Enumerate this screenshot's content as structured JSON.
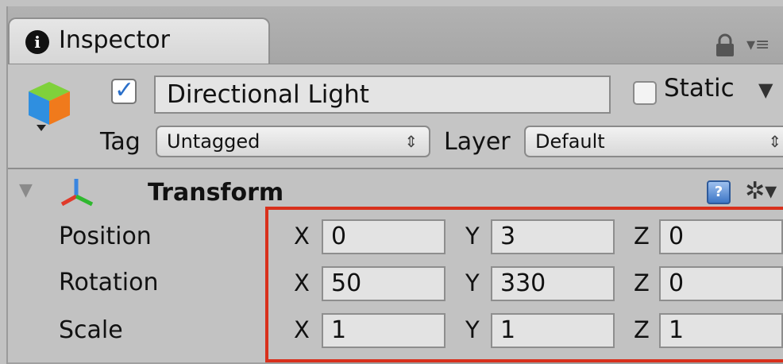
{
  "tab": {
    "icon": "info-icon",
    "icon_glyph": "i",
    "label": "Inspector"
  },
  "toolbar": {
    "lock_icon": "lock-icon",
    "menu_icon": "tab-menu-icon",
    "menu_glyph": "▾≡"
  },
  "gameobject": {
    "icon": "gameobject-cube-icon",
    "active_checked": true,
    "name": "Directional Light",
    "static_label": "Static",
    "static_checked": false,
    "static_dropdown_glyph": "▼",
    "tag_label": "Tag",
    "tag_value": "Untagged",
    "layer_label": "Layer",
    "layer_value": "Default",
    "dropdown_glyph": "⇕"
  },
  "component": {
    "foldout_glyph": "▼",
    "icon": "transform-axes-icon",
    "title": "Transform",
    "help_glyph": "?",
    "gear_glyph": "✲▾",
    "highlight_color": "#d8301c"
  },
  "transform": {
    "axis_labels": [
      "X",
      "Y",
      "Z"
    ],
    "rows": [
      {
        "label": "Position",
        "x": "0",
        "y": "3",
        "z": "0"
      },
      {
        "label": "Rotation",
        "x": "50",
        "y": "330",
        "z": "0"
      },
      {
        "label": "Scale",
        "x": "1",
        "y": "1",
        "z": "1"
      }
    ]
  }
}
